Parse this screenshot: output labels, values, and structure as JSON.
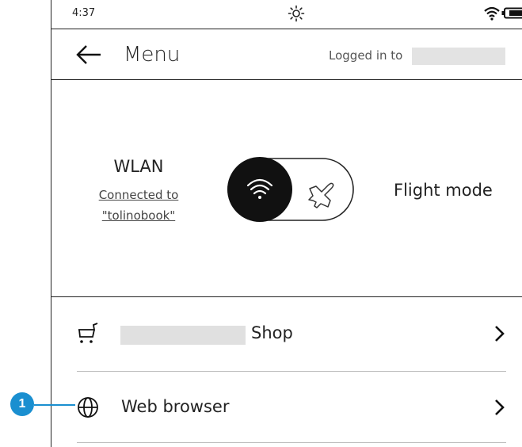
{
  "status_bar": {
    "time": "4:37",
    "icons": [
      "brightness-icon",
      "wifi-icon",
      "battery-icon"
    ]
  },
  "header": {
    "back_icon": "arrow-left-icon",
    "title": "Menu",
    "login_text": "Logged in to"
  },
  "wlan": {
    "label": "WLAN",
    "status_line1": "Connected to",
    "status_line2": "\"tolinobook\"",
    "toggle_state": "wlan",
    "flight_label": "Flight mode"
  },
  "menu": {
    "items": [
      {
        "icon": "shopping-cart-icon",
        "label": "Shop",
        "chevron": "chevron-right-icon"
      },
      {
        "icon": "globe-icon",
        "label": "Web browser",
        "chevron": "chevron-right-icon"
      }
    ]
  },
  "callout": {
    "number": "1",
    "color": "#1a8fd0"
  }
}
